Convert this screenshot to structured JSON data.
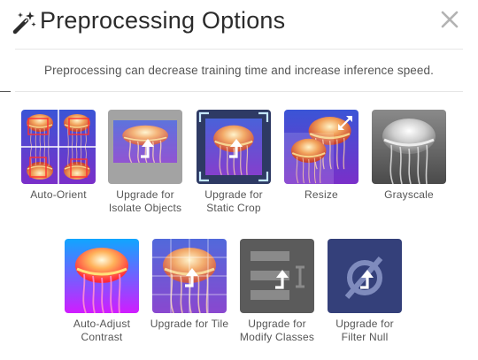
{
  "dialog": {
    "title": "Preprocessing Options",
    "subtitle": "Preprocessing can decrease training time and increase inference speed."
  },
  "icons": {
    "title": "magic-wand-icon",
    "close": "close-x-icon",
    "upgrade": "upgrade-arrow-icon"
  },
  "colors": {
    "title": "#2b2b2b",
    "label": "#555555",
    "divider": "#e6e6e6",
    "close": "#b3b3b3",
    "jellyfish_bg": "#5d37d1"
  },
  "options_row1": [
    {
      "label": "Auto-Orient"
    },
    {
      "label": "Upgrade for Isolate Objects"
    },
    {
      "label": "Upgrade for Static Crop"
    },
    {
      "label": "Resize"
    },
    {
      "label": "Grayscale"
    }
  ],
  "options_row2": [
    {
      "label": "Auto-Adjust Contrast"
    },
    {
      "label": "Upgrade for Tile"
    },
    {
      "label": "Upgrade for Modify Classes"
    },
    {
      "label": "Upgrade for Filter Null"
    }
  ]
}
